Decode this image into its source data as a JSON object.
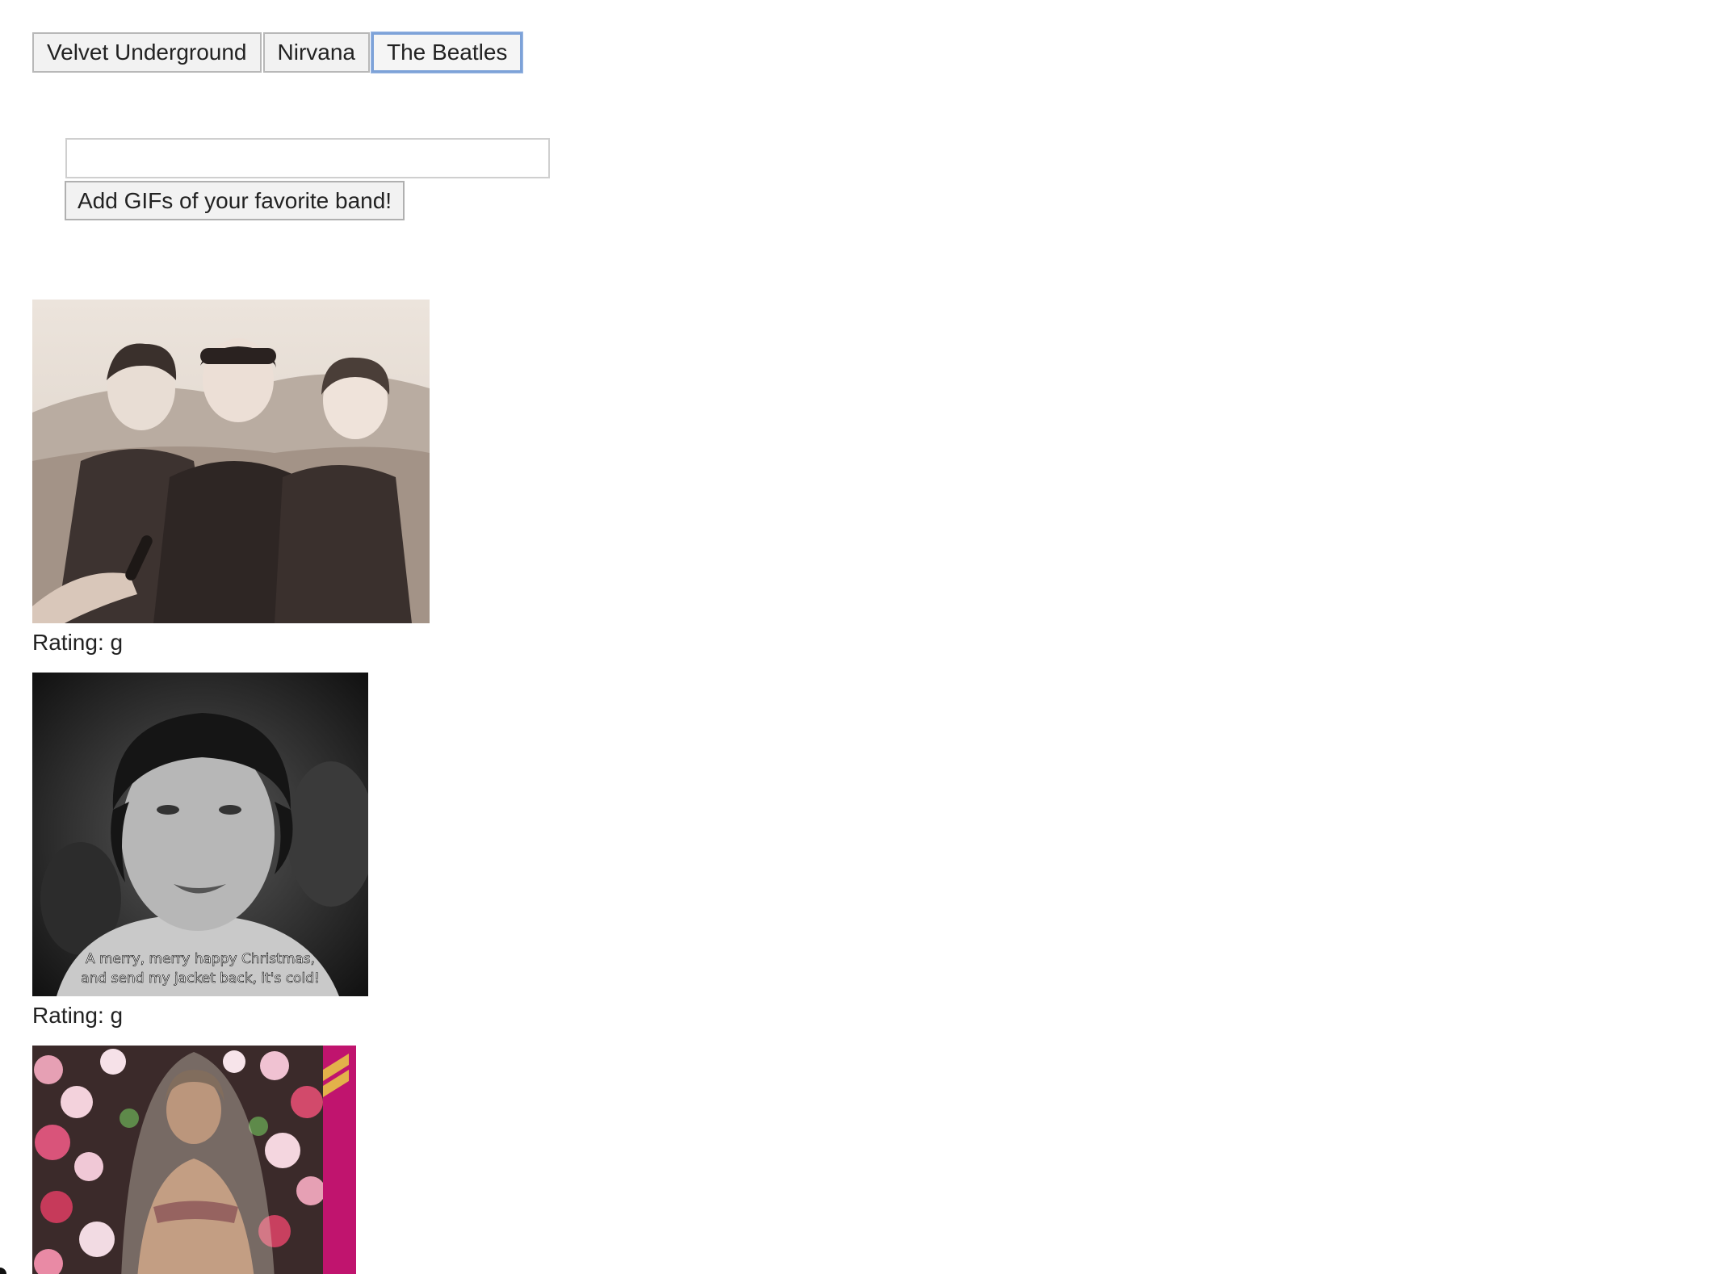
{
  "band_buttons": [
    {
      "label": "Velvet Underground",
      "active": false
    },
    {
      "label": "Nirvana",
      "active": false
    },
    {
      "label": "The Beatles",
      "active": true
    }
  ],
  "form": {
    "input_value": "",
    "add_button_label": "Add GIFs of your favorite band!"
  },
  "gifs": [
    {
      "rating_label": "Rating: g",
      "image": "beatles-group-photo"
    },
    {
      "rating_label": "Rating: g",
      "image": "george-harrison-closeup",
      "caption_line1": "A merry, merry happy Christmas,",
      "caption_line2": "and send my jacket back, it's cold!"
    },
    {
      "image": "woman-in-veil-with-flowers"
    }
  ]
}
